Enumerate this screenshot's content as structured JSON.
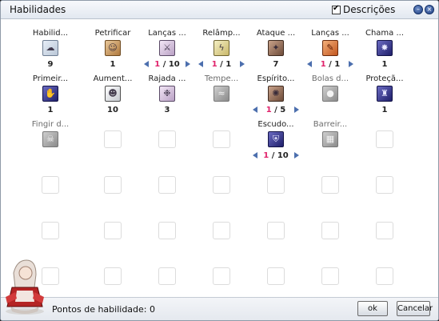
{
  "window": {
    "title": "Habilidades",
    "descriptions_label": "Descrições",
    "descriptions_checked": true
  },
  "footer": {
    "points_label": "Pontos de habilidade: 0",
    "ok_label": "ok",
    "cancel_label": "Cancelar"
  },
  "skills": [
    {
      "name": "Habilid...",
      "icon": "cloud-icon",
      "theme": "t-cloud",
      "level_display": "9",
      "row": 0,
      "col": 0
    },
    {
      "name": "Petrificar",
      "icon": "petrify-icon",
      "theme": "t-parch",
      "level_display": "1",
      "row": 0,
      "col": 1
    },
    {
      "name": "Lanças ...",
      "icon": "lance-icon",
      "theme": "t-scroll",
      "current": "1",
      "max": "/ 10",
      "row": 0,
      "col": 2
    },
    {
      "name": "Relâmp...",
      "icon": "lightning-icon",
      "theme": "t-scroll-y",
      "current": "1",
      "max": "/ 1",
      "row": 0,
      "col": 3
    },
    {
      "name": "Ataque ...",
      "icon": "attack-icon",
      "theme": "t-brown",
      "level_display": "7",
      "row": 0,
      "col": 4
    },
    {
      "name": "Lanças ...",
      "icon": "fire-lance-icon",
      "theme": "t-fire",
      "current": "1",
      "max": "/ 1",
      "row": 0,
      "col": 5
    },
    {
      "name": "Chama ...",
      "icon": "flame-icon",
      "theme": "t-purple",
      "level_display": "1",
      "row": 0,
      "col": 6
    },
    {
      "name": "Primeir...",
      "icon": "hand-icon",
      "theme": "t-purple",
      "level_display": "1",
      "row": 1,
      "col": 0
    },
    {
      "name": "Aument...",
      "icon": "head-icon",
      "theme": "t-bright",
      "level_display": "10",
      "row": 1,
      "col": 1
    },
    {
      "name": "Rajada ...",
      "icon": "burst-icon",
      "theme": "t-scroll",
      "level_display": "3",
      "row": 1,
      "col": 2
    },
    {
      "name": "Tempe...",
      "icon": "storm-icon",
      "theme": "t-gray",
      "dim": true,
      "row": 1,
      "col": 3
    },
    {
      "name": "Espírito...",
      "icon": "spirit-icon",
      "theme": "t-brown",
      "current": "1",
      "max": "/ 5",
      "row": 1,
      "col": 4
    },
    {
      "name": "Bolas d...",
      "icon": "ball-icon",
      "theme": "t-gray",
      "dim": true,
      "row": 1,
      "col": 5
    },
    {
      "name": "Proteçã...",
      "icon": "protection-icon",
      "theme": "t-purple",
      "level_display": "1",
      "row": 1,
      "col": 6
    },
    {
      "name": "Fingir d...",
      "icon": "fake-death-icon",
      "theme": "t-gray",
      "dim": true,
      "row": 2,
      "col": 0
    },
    {
      "name": "Escudo...",
      "icon": "shield-icon",
      "theme": "t-purple",
      "current": "1",
      "max": "/ 10",
      "row": 2,
      "col": 4
    },
    {
      "name": "Barreir...",
      "icon": "barrier-icon",
      "theme": "t-gray",
      "dim": true,
      "row": 2,
      "col": 5
    }
  ]
}
